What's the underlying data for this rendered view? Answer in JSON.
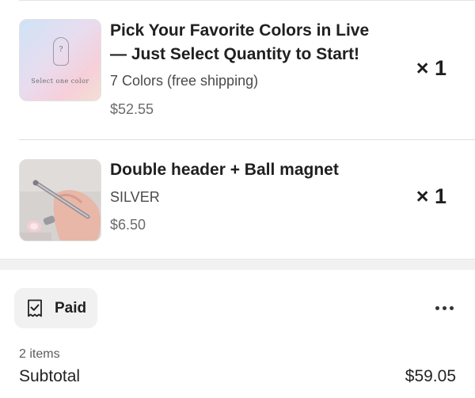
{
  "items": [
    {
      "title": "Pick Your Favorite Colors in Live — Just Select Quantity to Start!",
      "title_line1": "Pick Your Favorite Colors in Live",
      "title_line2": "— Just Select Quantity to Start!",
      "variant": "7 Colors (free shipping)",
      "price": "$52.55",
      "quantity": "× 1",
      "thumbnail_text": "Select one color",
      "thumbnail_mark": "?"
    },
    {
      "title": "Double header + Ball magnet",
      "variant": "SILVER",
      "price": "$6.50",
      "quantity": "× 1"
    }
  ],
  "payment": {
    "status_label": "Paid",
    "status_icon": "receipt-check-icon",
    "more_icon": "more-horizontal-icon"
  },
  "summary": {
    "items_count": "2 items",
    "subtotal_label": "Subtotal",
    "subtotal_value": "$59.05"
  },
  "colors": {
    "background": "#ffffff",
    "badge_background": "#f1f1f1",
    "text_primary": "#1f1f1f",
    "text_secondary": "#6b6b6b"
  }
}
